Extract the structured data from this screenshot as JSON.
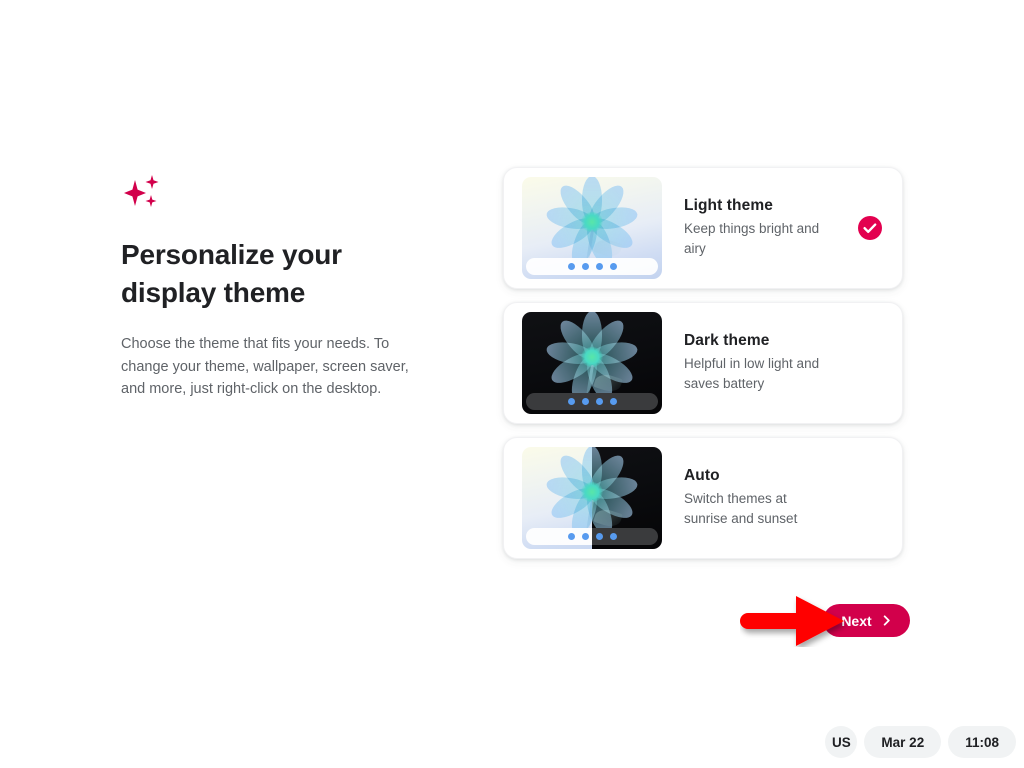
{
  "page": {
    "headline_line1": "Personalize your",
    "headline_line2": "display theme",
    "body": "Choose the theme that fits your needs. To change your theme, wallpaper, screen saver, and more, just right-click on the desktop.",
    "sparkle_icon": "sparkle-icon",
    "accent_color": "#d2004b",
    "background_color": "#ffffff"
  },
  "themes": [
    {
      "title": "Light theme",
      "description": "Keep things bright and airy",
      "selected": true,
      "preview": "light"
    },
    {
      "title": "Dark theme",
      "description": "Helpful in low light and saves battery",
      "selected": false,
      "preview": "dark"
    },
    {
      "title": "Auto",
      "description": "Switch themes at sunrise and sunset",
      "selected": false,
      "preview": "split"
    }
  ],
  "footer": {
    "next_label": "Next",
    "next_icon": "chevron-right-icon",
    "arrow_annotation": "red-arrow-pointer",
    "arrow_color": "#ff0000"
  },
  "status": {
    "locale": "US",
    "date": "Mar 22",
    "time": "11:08"
  }
}
